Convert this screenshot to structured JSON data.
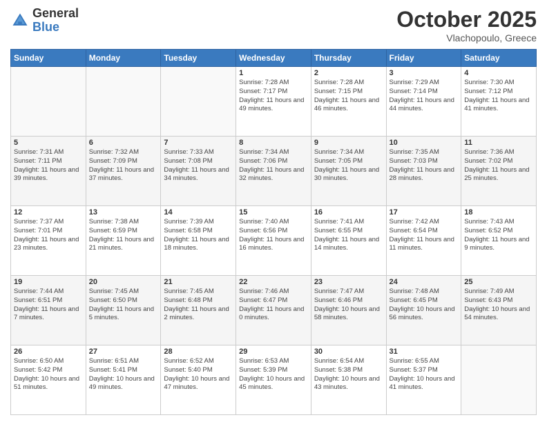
{
  "logo": {
    "general": "General",
    "blue": "Blue"
  },
  "title": "October 2025",
  "location": "Vlachopoulo, Greece",
  "headers": [
    "Sunday",
    "Monday",
    "Tuesday",
    "Wednesday",
    "Thursday",
    "Friday",
    "Saturday"
  ],
  "weeks": [
    [
      {
        "day": "",
        "sunrise": "",
        "sunset": "",
        "daylight": ""
      },
      {
        "day": "",
        "sunrise": "",
        "sunset": "",
        "daylight": ""
      },
      {
        "day": "",
        "sunrise": "",
        "sunset": "",
        "daylight": ""
      },
      {
        "day": "1",
        "sunrise": "Sunrise: 7:28 AM",
        "sunset": "Sunset: 7:17 PM",
        "daylight": "Daylight: 11 hours and 49 minutes."
      },
      {
        "day": "2",
        "sunrise": "Sunrise: 7:28 AM",
        "sunset": "Sunset: 7:15 PM",
        "daylight": "Daylight: 11 hours and 46 minutes."
      },
      {
        "day": "3",
        "sunrise": "Sunrise: 7:29 AM",
        "sunset": "Sunset: 7:14 PM",
        "daylight": "Daylight: 11 hours and 44 minutes."
      },
      {
        "day": "4",
        "sunrise": "Sunrise: 7:30 AM",
        "sunset": "Sunset: 7:12 PM",
        "daylight": "Daylight: 11 hours and 41 minutes."
      }
    ],
    [
      {
        "day": "5",
        "sunrise": "Sunrise: 7:31 AM",
        "sunset": "Sunset: 7:11 PM",
        "daylight": "Daylight: 11 hours and 39 minutes."
      },
      {
        "day": "6",
        "sunrise": "Sunrise: 7:32 AM",
        "sunset": "Sunset: 7:09 PM",
        "daylight": "Daylight: 11 hours and 37 minutes."
      },
      {
        "day": "7",
        "sunrise": "Sunrise: 7:33 AM",
        "sunset": "Sunset: 7:08 PM",
        "daylight": "Daylight: 11 hours and 34 minutes."
      },
      {
        "day": "8",
        "sunrise": "Sunrise: 7:34 AM",
        "sunset": "Sunset: 7:06 PM",
        "daylight": "Daylight: 11 hours and 32 minutes."
      },
      {
        "day": "9",
        "sunrise": "Sunrise: 7:34 AM",
        "sunset": "Sunset: 7:05 PM",
        "daylight": "Daylight: 11 hours and 30 minutes."
      },
      {
        "day": "10",
        "sunrise": "Sunrise: 7:35 AM",
        "sunset": "Sunset: 7:03 PM",
        "daylight": "Daylight: 11 hours and 28 minutes."
      },
      {
        "day": "11",
        "sunrise": "Sunrise: 7:36 AM",
        "sunset": "Sunset: 7:02 PM",
        "daylight": "Daylight: 11 hours and 25 minutes."
      }
    ],
    [
      {
        "day": "12",
        "sunrise": "Sunrise: 7:37 AM",
        "sunset": "Sunset: 7:01 PM",
        "daylight": "Daylight: 11 hours and 23 minutes."
      },
      {
        "day": "13",
        "sunrise": "Sunrise: 7:38 AM",
        "sunset": "Sunset: 6:59 PM",
        "daylight": "Daylight: 11 hours and 21 minutes."
      },
      {
        "day": "14",
        "sunrise": "Sunrise: 7:39 AM",
        "sunset": "Sunset: 6:58 PM",
        "daylight": "Daylight: 11 hours and 18 minutes."
      },
      {
        "day": "15",
        "sunrise": "Sunrise: 7:40 AM",
        "sunset": "Sunset: 6:56 PM",
        "daylight": "Daylight: 11 hours and 16 minutes."
      },
      {
        "day": "16",
        "sunrise": "Sunrise: 7:41 AM",
        "sunset": "Sunset: 6:55 PM",
        "daylight": "Daylight: 11 hours and 14 minutes."
      },
      {
        "day": "17",
        "sunrise": "Sunrise: 7:42 AM",
        "sunset": "Sunset: 6:54 PM",
        "daylight": "Daylight: 11 hours and 11 minutes."
      },
      {
        "day": "18",
        "sunrise": "Sunrise: 7:43 AM",
        "sunset": "Sunset: 6:52 PM",
        "daylight": "Daylight: 11 hours and 9 minutes."
      }
    ],
    [
      {
        "day": "19",
        "sunrise": "Sunrise: 7:44 AM",
        "sunset": "Sunset: 6:51 PM",
        "daylight": "Daylight: 11 hours and 7 minutes."
      },
      {
        "day": "20",
        "sunrise": "Sunrise: 7:45 AM",
        "sunset": "Sunset: 6:50 PM",
        "daylight": "Daylight: 11 hours and 5 minutes."
      },
      {
        "day": "21",
        "sunrise": "Sunrise: 7:45 AM",
        "sunset": "Sunset: 6:48 PM",
        "daylight": "Daylight: 11 hours and 2 minutes."
      },
      {
        "day": "22",
        "sunrise": "Sunrise: 7:46 AM",
        "sunset": "Sunset: 6:47 PM",
        "daylight": "Daylight: 11 hours and 0 minutes."
      },
      {
        "day": "23",
        "sunrise": "Sunrise: 7:47 AM",
        "sunset": "Sunset: 6:46 PM",
        "daylight": "Daylight: 10 hours and 58 minutes."
      },
      {
        "day": "24",
        "sunrise": "Sunrise: 7:48 AM",
        "sunset": "Sunset: 6:45 PM",
        "daylight": "Daylight: 10 hours and 56 minutes."
      },
      {
        "day": "25",
        "sunrise": "Sunrise: 7:49 AM",
        "sunset": "Sunset: 6:43 PM",
        "daylight": "Daylight: 10 hours and 54 minutes."
      }
    ],
    [
      {
        "day": "26",
        "sunrise": "Sunrise: 6:50 AM",
        "sunset": "Sunset: 5:42 PM",
        "daylight": "Daylight: 10 hours and 51 minutes."
      },
      {
        "day": "27",
        "sunrise": "Sunrise: 6:51 AM",
        "sunset": "Sunset: 5:41 PM",
        "daylight": "Daylight: 10 hours and 49 minutes."
      },
      {
        "day": "28",
        "sunrise": "Sunrise: 6:52 AM",
        "sunset": "Sunset: 5:40 PM",
        "daylight": "Daylight: 10 hours and 47 minutes."
      },
      {
        "day": "29",
        "sunrise": "Sunrise: 6:53 AM",
        "sunset": "Sunset: 5:39 PM",
        "daylight": "Daylight: 10 hours and 45 minutes."
      },
      {
        "day": "30",
        "sunrise": "Sunrise: 6:54 AM",
        "sunset": "Sunset: 5:38 PM",
        "daylight": "Daylight: 10 hours and 43 minutes."
      },
      {
        "day": "31",
        "sunrise": "Sunrise: 6:55 AM",
        "sunset": "Sunset: 5:37 PM",
        "daylight": "Daylight: 10 hours and 41 minutes."
      },
      {
        "day": "",
        "sunrise": "",
        "sunset": "",
        "daylight": ""
      }
    ]
  ]
}
